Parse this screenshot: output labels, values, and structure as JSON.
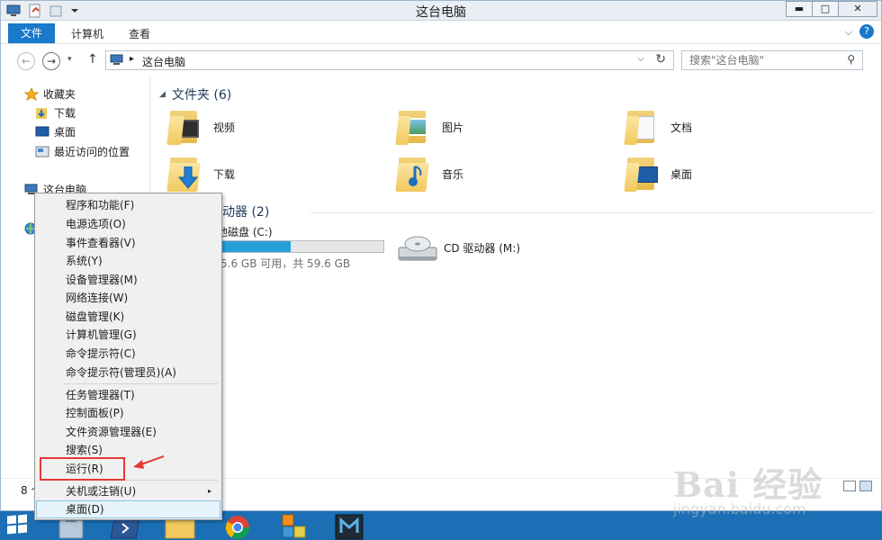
{
  "window": {
    "title": "这台电脑",
    "controls": {
      "minimize": "▬",
      "maximize": "□",
      "close": "✕"
    }
  },
  "ribbon": {
    "tabs": [
      {
        "label": "文件",
        "active": true
      },
      {
        "label": "计算机"
      },
      {
        "label": "查看"
      }
    ],
    "expand_glyph": "⌵",
    "help_glyph": "?"
  },
  "address": {
    "back_glyph": "←",
    "forward_glyph": "→",
    "recent_glyph": "▾",
    "up_glyph": "↑",
    "separator": "▸",
    "breadcrumb": "这台电脑",
    "dropdown_glyph": "⌵",
    "refresh_glyph": "↻"
  },
  "search": {
    "placeholder": "搜索\"这台电脑\"",
    "icon_glyph": "⚲"
  },
  "navpane": {
    "favorites": "收藏夹",
    "favorite_items": [
      "下载",
      "桌面",
      "最近访问的位置"
    ],
    "this_pc": "这台电脑"
  },
  "folders_group": {
    "heading": "文件夹 (6)",
    "items": [
      "视频",
      "图片",
      "文档",
      "下载",
      "音乐",
      "桌面"
    ]
  },
  "drives_group": {
    "heading_partial": "动器 (2)",
    "local_disk": {
      "label_partial": "本地磁盘 (C:)",
      "usage_partial": "5.6 GB 可用，共 59.6 GB",
      "used_fraction": 0.43
    },
    "cd_drive": {
      "label": "CD 驱动器 (M:)"
    }
  },
  "status": {
    "count_partial": "8 个"
  },
  "context_menu": {
    "items": [
      "程序和功能(F)",
      "电源选项(O)",
      "事件查看器(V)",
      "系统(Y)",
      "设备管理器(M)",
      "网络连接(W)",
      "磁盘管理(K)",
      "计算机管理(G)",
      "命令提示符(C)",
      "命令提示符(管理员)(A)",
      "任务管理器(T)",
      "控制面板(P)",
      "文件资源管理器(E)",
      "搜索(S)",
      "运行(R)",
      "关机或注销(U)",
      "桌面(D)"
    ],
    "submenu_glyph": "▸"
  },
  "watermark": {
    "brand": "Bai 经验",
    "url": "jingyan.baidu.com"
  },
  "colors": {
    "accent": "#1979ca",
    "taskbar": "#1c6fb4",
    "drive_fill": "#26a0da",
    "annotation_red": "#e53935"
  }
}
